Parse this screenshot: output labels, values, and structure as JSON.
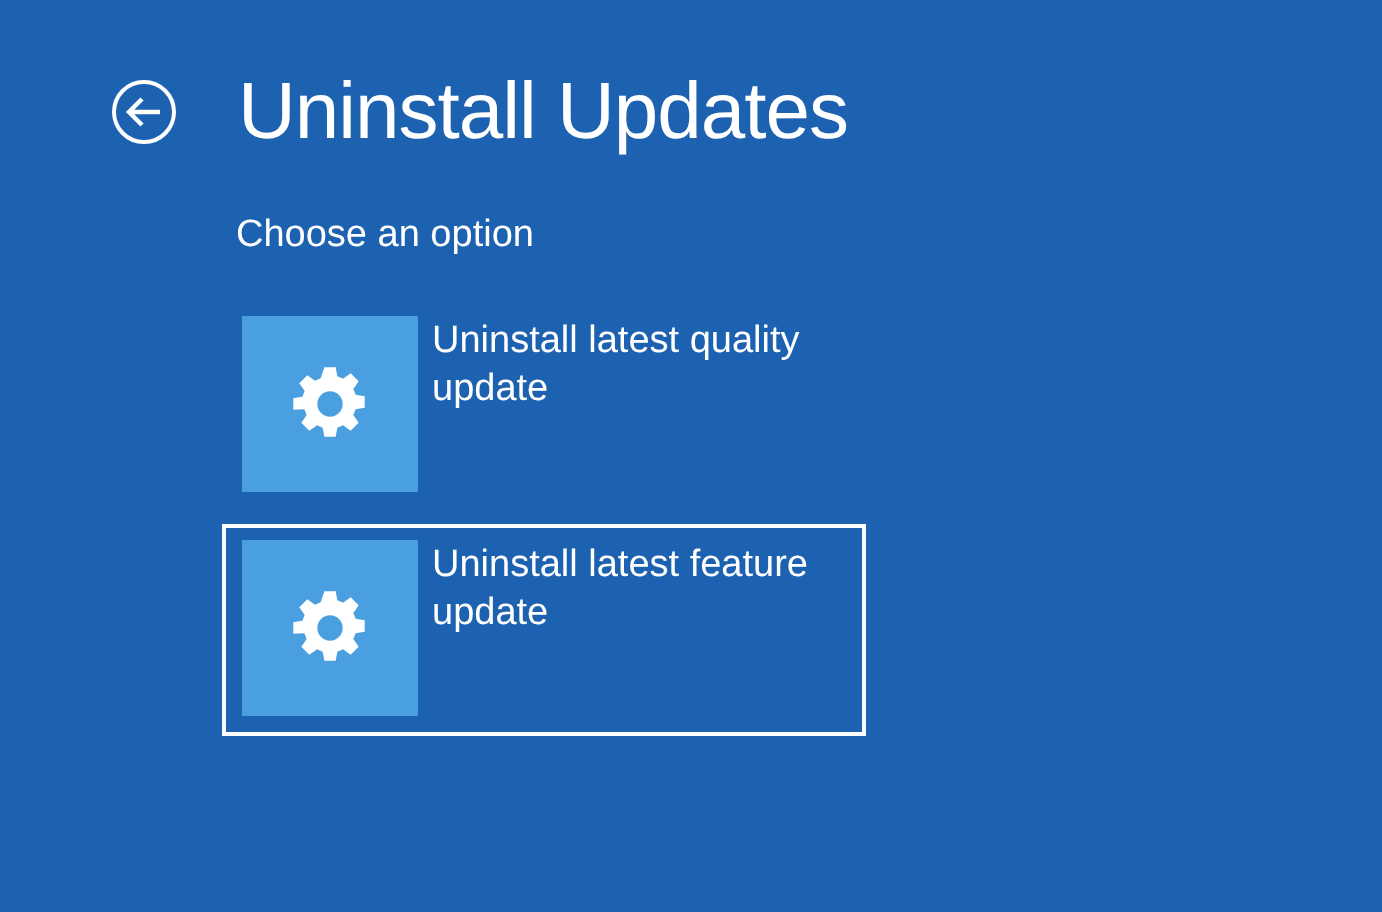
{
  "title": "Uninstall Updates",
  "subtitle": "Choose an option",
  "options": [
    {
      "label": "Uninstall latest quality update",
      "selected": false
    },
    {
      "label": "Uninstall latest feature update",
      "selected": true
    }
  ]
}
